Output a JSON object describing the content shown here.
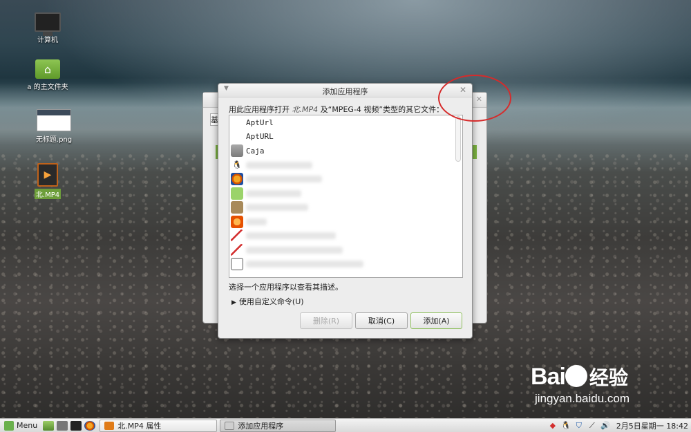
{
  "desktop": {
    "icons": [
      {
        "label": "计算机",
        "icon": "computer-icon"
      },
      {
        "label": "a 的主文件夹",
        "icon": "home-folder-icon"
      },
      {
        "label": "无标题.png",
        "icon": "image-file-icon"
      },
      {
        "label": "北.MP4",
        "icon": "video-file-icon"
      }
    ]
  },
  "dialog": {
    "title": "添加应用程序",
    "prompt_prefix": "用此应用程序打开 ",
    "file_name": "北.MP4",
    "prompt_suffix": " 及“MPEG-4 视频”类型的其它文件：",
    "apps": [
      {
        "name": "AptUrl",
        "icon": "blank"
      },
      {
        "name": "AptURL",
        "icon": "blank"
      },
      {
        "name": "Caja",
        "icon": "folder-icon"
      }
    ],
    "hint": "选择一个应用程序以查看其描述。",
    "custom_command": "使用自定义命令(U)",
    "buttons": {
      "remove": "删除(R)",
      "cancel": "取消(C)",
      "add": "添加(A)"
    }
  },
  "background_window": {
    "tab_label": "基"
  },
  "watermark": {
    "brand": "Bai",
    "brand_suffix": "经验",
    "url": "jingyan.baidu.com"
  },
  "taskbar": {
    "menu_label": "Menu",
    "tasks": [
      {
        "label": "北.MP4 属性"
      },
      {
        "label": "添加应用程序"
      }
    ],
    "clock": "2月5日星期一 18:42"
  },
  "colors": {
    "accent_green": "#7cb342",
    "annotation_red": "#d62b2b"
  }
}
